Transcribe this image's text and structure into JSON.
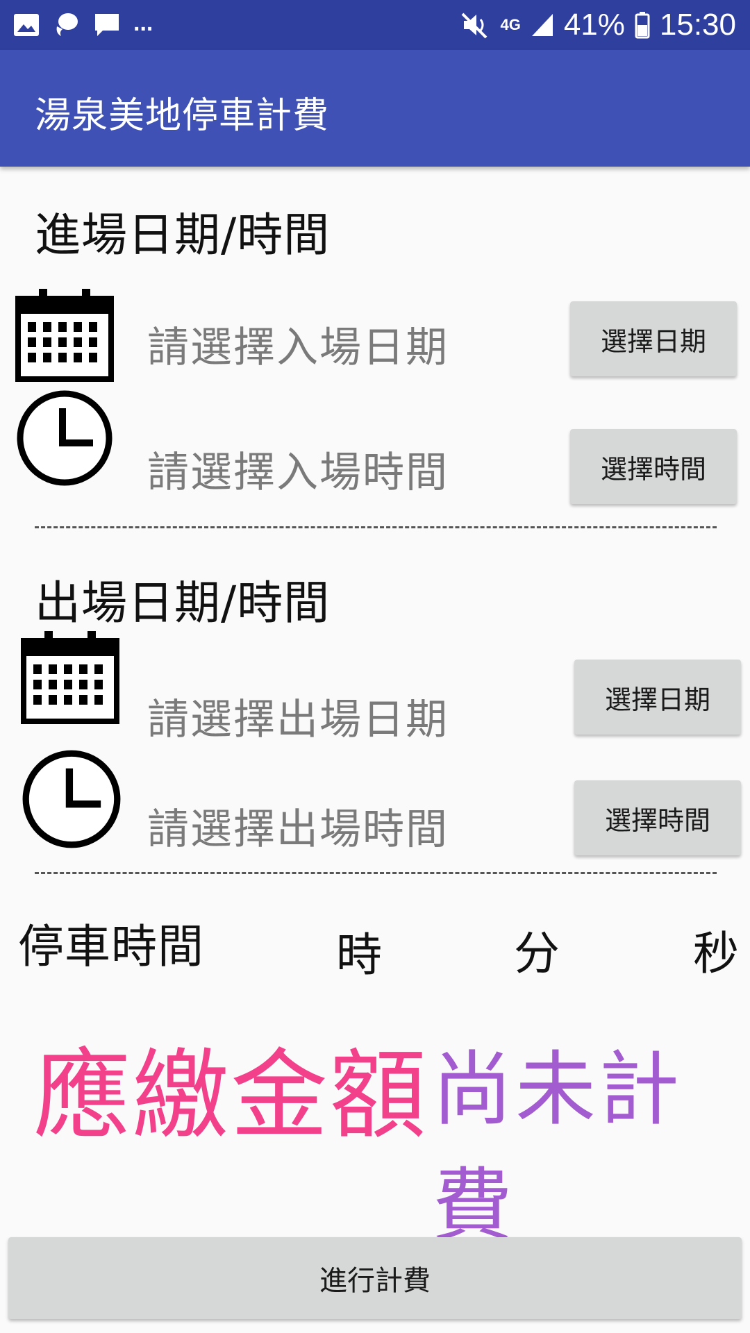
{
  "status_bar": {
    "left_icons": [
      "gallery-icon",
      "messenger-icon",
      "chat-icon"
    ],
    "more": "...",
    "network": "4G",
    "battery": "41%",
    "time": "15:30"
  },
  "app_bar": {
    "title": "湯泉美地停車計費"
  },
  "entry": {
    "heading": "進場日期/時間",
    "date_placeholder": "請選擇入場日期",
    "date_button": "選擇日期",
    "time_placeholder": "請選擇入場時間",
    "time_button": "選擇時間"
  },
  "exit": {
    "heading": "出場日期/時間",
    "date_placeholder": "請選擇出場日期",
    "date_button": "選擇日期",
    "time_placeholder": "請選擇出場時間",
    "time_button": "選擇時間"
  },
  "duration": {
    "label": "停車時間",
    "hours_unit": "時",
    "minutes_unit": "分",
    "seconds_unit": "秒"
  },
  "fee": {
    "label": "應繳金額",
    "value": "尚未計費",
    "label_color": "#f2418a",
    "value_color": "#a35bd0"
  },
  "calculate_button": "進行計費",
  "colors": {
    "status_bar": "#2f3f9e",
    "app_bar": "#3f51b5"
  }
}
